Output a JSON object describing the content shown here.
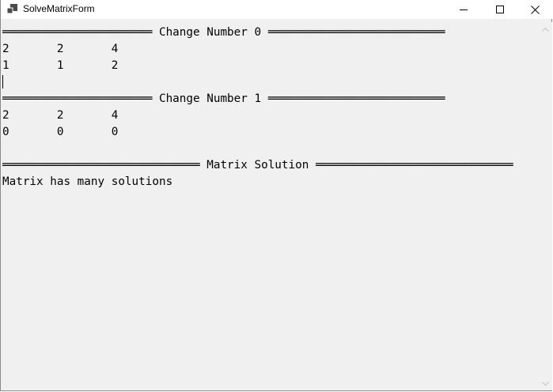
{
  "window": {
    "title": "SolveMatrixForm"
  },
  "output": {
    "lines": [
      "══════════════════════ Change Number 0 ══════════════════════════",
      "2       2       4",
      "1       1       2",
      "",
      "══════════════════════ Change Number 1 ══════════════════════════",
      "2       2       4",
      "0       0       0",
      "",
      "═════════════════════════════ Matrix Solution ═════════════════════════════",
      "Matrix has many solutions"
    ]
  },
  "icons": {
    "app": "app-window-icon",
    "minimize": "minimize-icon",
    "maximize": "maximize-icon",
    "close": "close-icon",
    "scroll_up": "chevron-up-icon",
    "scroll_down": "chevron-down-icon"
  }
}
